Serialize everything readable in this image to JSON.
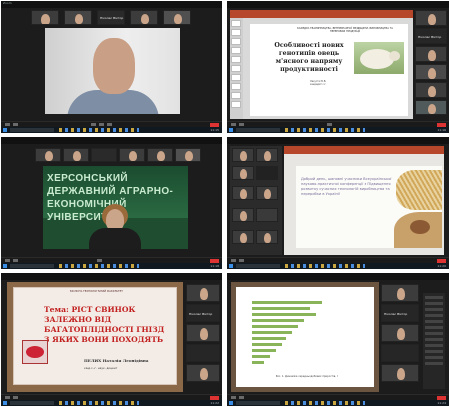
{
  "panels": [
    {
      "id": "p1",
      "app_title": "Zoom",
      "speaker_name": "",
      "thumbnail_names": [
        "Ніколас Віктор",
        "",
        "",
        "",
        ""
      ],
      "clock": "11:15"
    },
    {
      "id": "p2",
      "slide_header": "КАФЕДРА ТВАРИННИЦТВА, ВЕТЕРИНАРНОЇ МЕДИЦИНИ, ВИРОБНИЦТВА ТА ПЕРЕРОБКИ ПРОДУКЦІЇ",
      "slide_title": "Особливості нових генотипів овець м'ясного напряму продуктивності",
      "slide_authors": "Лакуста Ю.В.\nкандидат с.г.",
      "side_names": [
        "Ніколас Віктор",
        "",
        "",
        ""
      ],
      "clock": "11:16"
    },
    {
      "id": "p3",
      "wall_text": "ХЕРСОНСЬКИЙ ДЕРЖАВНИЙ АГРАРНО-ЕКОНОМІЧНИЙ УНІВЕРСИТЕТ",
      "speaker_name": "",
      "clock": "11:18"
    },
    {
      "id": "p4",
      "slide_text": "Добрий день, шановні учасники Всеукраїнської науково-практичної конференції з Підвищення розвитку сучасних технологій виробництва та переробки в Україні!",
      "clock": "11:20"
    },
    {
      "id": "p5",
      "slide_header": "БІОЛОГО-ТЕХНОЛОГІЧНИЙ ФАКУЛЬТЕТ",
      "slide_title": "Тема: РІСТ СВИНОК ЗАЛЕЖНО ВІД БАГАТОПЛІДНОСТІ ГНІЗД З ЯКИХ ВОНИ ПОХОДЯТЬ",
      "author": "ПЕЛИХ Наталія Леонідівна",
      "degree": "кінд.с.-г. наук, доцент",
      "side_names": [
        "Ніколас Віктор",
        ""
      ],
      "clock": "11:22"
    },
    {
      "id": "p6",
      "caption": "Рис. 1. Динаміка середньодобових приростів, г",
      "side_names": [
        "Ніколас Віктор",
        ""
      ],
      "clock": "11:24"
    }
  ]
}
